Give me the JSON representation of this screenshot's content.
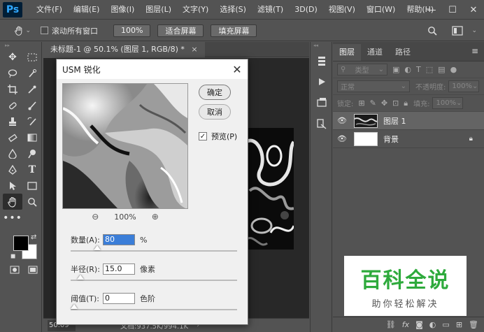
{
  "app": {
    "logo": "Ps"
  },
  "menu": [
    "文件(F)",
    "编辑(E)",
    "图像(I)",
    "图层(L)",
    "文字(Y)",
    "选择(S)",
    "滤镜(T)",
    "3D(D)",
    "视图(V)",
    "窗口(W)",
    "帮助(H)"
  ],
  "window_controls": {
    "minimize": "—",
    "maximize": "☐",
    "close": "✕"
  },
  "options": {
    "scroll_all_label": "滚动所有窗口",
    "zoom_value": "100%",
    "fit_screen": "适合屏幕",
    "fill_screen": "填充屏幕"
  },
  "document": {
    "tab_title": "未标题-1 @ 50.1% (图层 1, RGB/8) *",
    "close": "×",
    "status_zoom": "50.09 %",
    "status_doc": "文档:937.5K/994.1K"
  },
  "layers_panel": {
    "tabs": [
      "图层",
      "通道",
      "路径"
    ],
    "kind_placeholder": "类型",
    "blend_mode": "正常",
    "opacity_label": "不透明度:",
    "opacity_value": "100%",
    "lock_label": "锁定:",
    "fill_label": "填充:",
    "fill_value": "100%",
    "layers": [
      {
        "name": "图层 1",
        "selected": true,
        "thumb": "dark"
      },
      {
        "name": "背景",
        "selected": false,
        "thumb": "white",
        "locked": true
      }
    ]
  },
  "dialog": {
    "title": "USM 锐化",
    "ok": "确定",
    "cancel": "取消",
    "preview_label": "预览(P)",
    "preview_checked": true,
    "zoom_value": "100%",
    "amount_label": "数量(A):",
    "amount_value": "80",
    "amount_unit": "%",
    "radius_label": "半径(R):",
    "radius_value": "15.0",
    "radius_unit": "像素",
    "threshold_label": "阈值(T):",
    "threshold_value": "0",
    "threshold_unit": "色阶",
    "amount_fraction": 0.16,
    "radius_fraction": 0.06,
    "threshold_fraction": 0.0
  },
  "watermark": {
    "title": "百科全说",
    "subtitle": "助你轻松解决"
  },
  "colors": {
    "watermark_green": "#2eaa3c",
    "ps_blue": "#31a8ff"
  }
}
